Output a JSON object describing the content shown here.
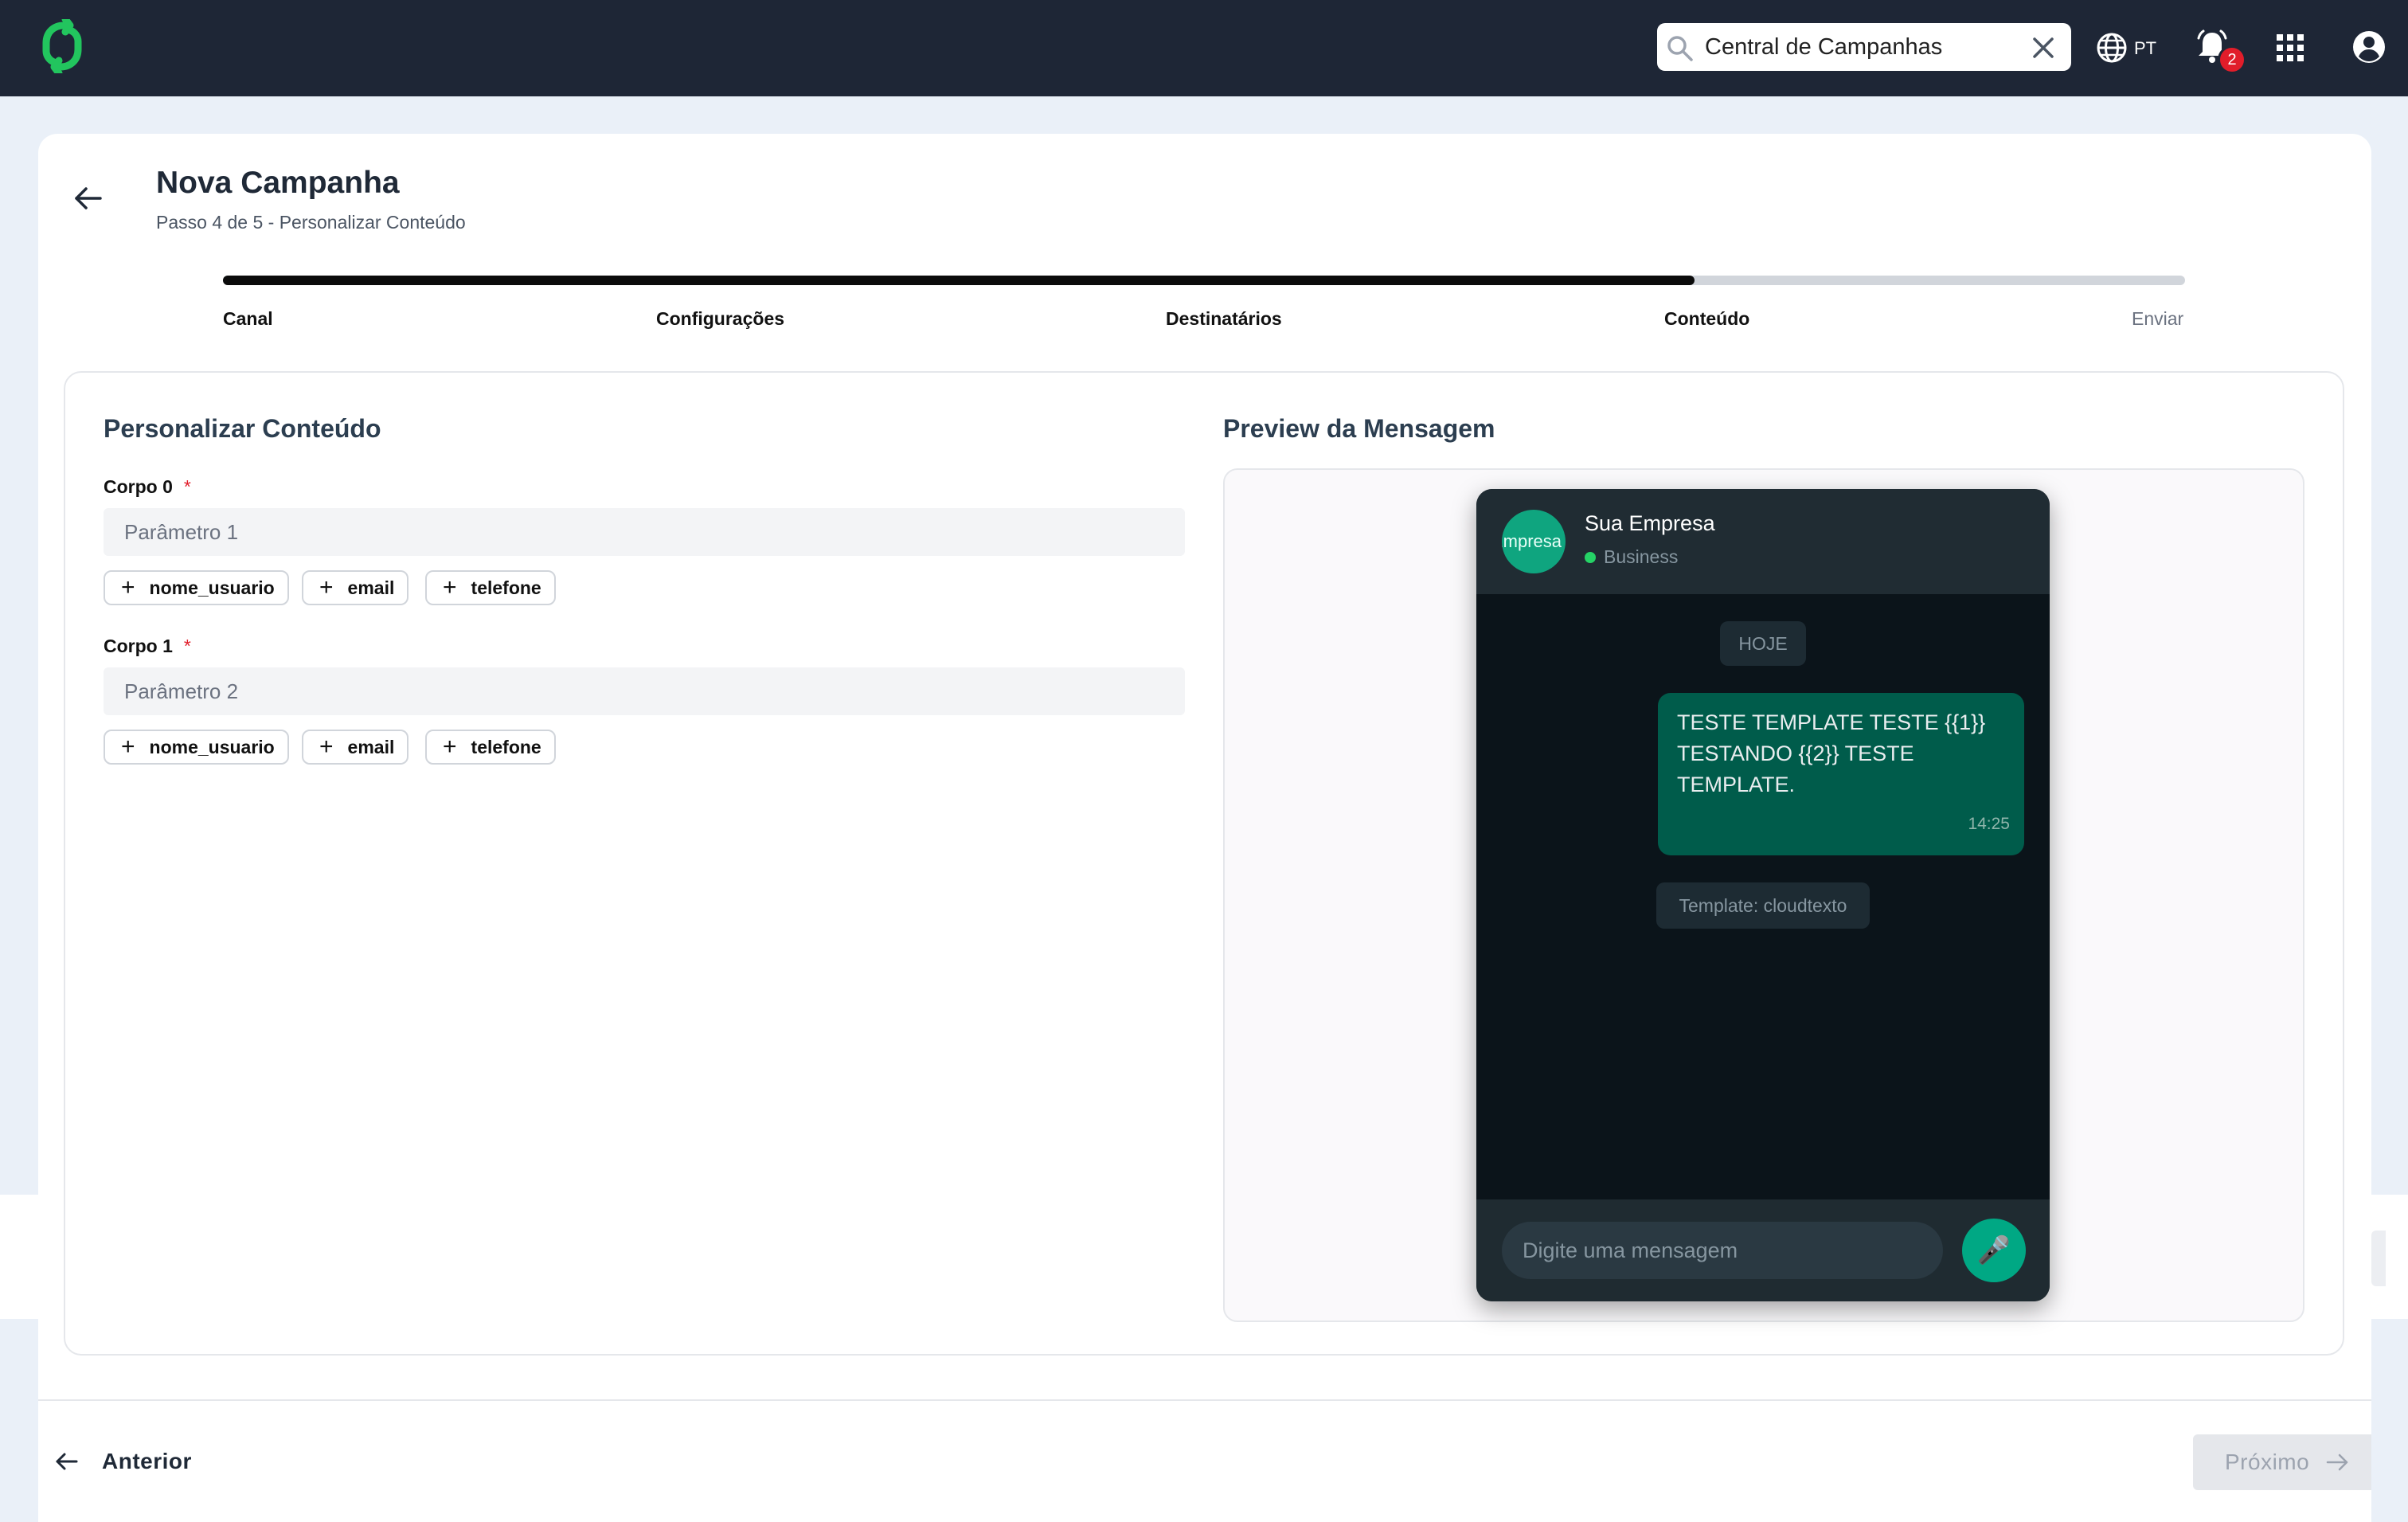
{
  "topbar": {
    "search_value": "Central de Campanhas",
    "language": "PT",
    "notification_count": "2",
    "icons": [
      "logo-icon",
      "search-icon",
      "close-icon",
      "globe-icon",
      "bell-icon",
      "apps-grid-icon",
      "user-circle-icon"
    ]
  },
  "header": {
    "title": "Nova Campanha",
    "subtitle": "Passo 4 de 5 - Personalizar Conteúdo"
  },
  "progress": {
    "current_step": 4,
    "total_steps": 5,
    "fill_fraction": 0.75
  },
  "steps": [
    {
      "label": "Canal",
      "active": true
    },
    {
      "label": "Configurações",
      "active": true
    },
    {
      "label": "Destinatários",
      "active": true
    },
    {
      "label": "Conteúdo",
      "active": true
    },
    {
      "label": "Enviar",
      "active": false
    }
  ],
  "content": {
    "section_title": "Personalizar Conteúdo",
    "required_mark": "*",
    "fields": [
      {
        "label": "Corpo 0",
        "placeholder": "Parâmetro 1",
        "chips": [
          "nome_usuario",
          "email",
          "telefone"
        ]
      },
      {
        "label": "Corpo 1",
        "placeholder": "Parâmetro 2",
        "chips": [
          "nome_usuario",
          "email",
          "telefone"
        ]
      }
    ],
    "chip_prefix": "+"
  },
  "preview": {
    "section_title": "Preview da Mensagem",
    "avatar_text": "Empresa",
    "company_name": "Sua Empresa",
    "company_status": "Business",
    "day_label": "HOJE",
    "message_text": "TESTE TEMPLATE TESTE {{1}} TESTANDO {{2}} TESTE TEMPLATE.",
    "message_time": "14:25",
    "template_label": "Template: cloudtexto",
    "input_placeholder": "Digite uma mensagem",
    "mic_glyph": "🎤"
  },
  "footer": {
    "prev_label": "Anterior",
    "next_label": "Próximo"
  },
  "colors": {
    "topbar_bg": "#1e2636",
    "logo_green": "#22c55e",
    "whatsapp_bubble": "#005c4b",
    "whatsapp_accent": "#00a884",
    "required_red": "#e11d2a"
  }
}
